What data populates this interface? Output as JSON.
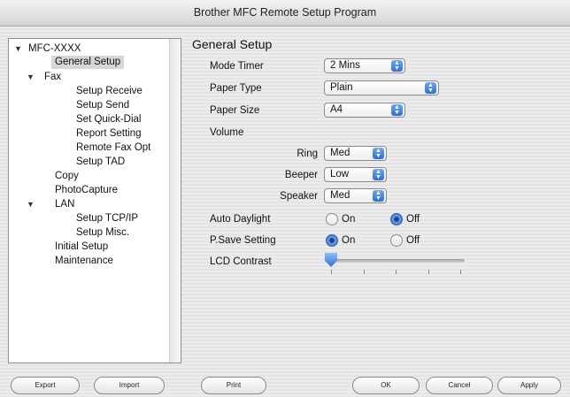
{
  "window": {
    "title": "Brother MFC Remote Setup Program"
  },
  "tree": {
    "items": [
      {
        "label": "MFC-XXXX"
      },
      {
        "label": "General Setup"
      },
      {
        "label": "Fax"
      },
      {
        "label": "Setup Receive"
      },
      {
        "label": "Setup Send"
      },
      {
        "label": "Set Quick-Dial"
      },
      {
        "label": "Report Setting"
      },
      {
        "label": "Remote Fax Opt"
      },
      {
        "label": "Setup TAD"
      },
      {
        "label": "Copy"
      },
      {
        "label": "PhotoCapture"
      },
      {
        "label": "LAN"
      },
      {
        "label": "Setup TCP/IP"
      },
      {
        "label": "Setup Misc."
      },
      {
        "label": "Initial Setup"
      },
      {
        "label": "Maintenance"
      }
    ],
    "selected": "General Setup"
  },
  "main": {
    "title": "General Setup",
    "mode_timer": {
      "label": "Mode Timer",
      "value": "2 Mins"
    },
    "paper_type": {
      "label": "Paper Type",
      "value": "Plain"
    },
    "paper_size": {
      "label": "Paper Size",
      "value": "A4"
    },
    "volume": {
      "label": "Volume",
      "ring": {
        "label": "Ring",
        "value": "Med"
      },
      "beeper": {
        "label": "Beeper",
        "value": "Low"
      },
      "speaker": {
        "label": "Speaker",
        "value": "Med"
      }
    },
    "auto_daylight": {
      "label": "Auto Daylight",
      "on_label": "On",
      "off_label": "Off",
      "selected": "Off"
    },
    "psave": {
      "label": "P.Save Setting",
      "on_label": "On",
      "off_label": "Off",
      "selected": "On"
    },
    "lcd_contrast": {
      "label": "LCD Contrast",
      "level": 0,
      "steps": 5
    }
  },
  "buttons": {
    "export": "Export",
    "import": "Import",
    "print": "Print",
    "ok": "OK",
    "cancel": "Cancel",
    "apply": "Apply"
  }
}
